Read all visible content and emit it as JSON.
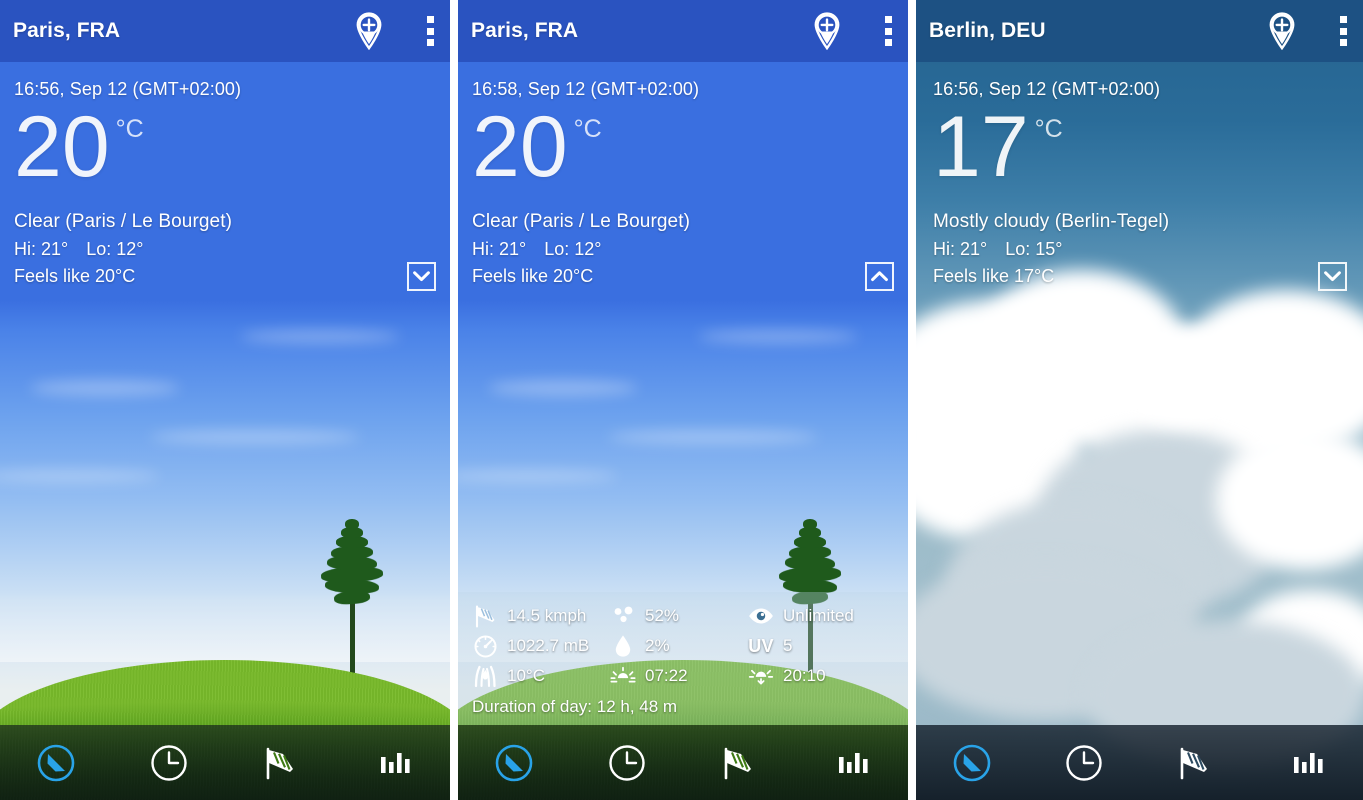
{
  "app": {
    "nav": {
      "items": [
        {
          "name": "now",
          "icon": "navigation-arrow-icon",
          "active": true
        },
        {
          "name": "hourly",
          "icon": "clock-icon",
          "active": false
        },
        {
          "name": "wind",
          "icon": "windsock-icon",
          "active": false
        },
        {
          "name": "charts",
          "icon": "bar-chart-icon",
          "active": false
        }
      ]
    },
    "colors": {
      "header_blue": "#2a53c0",
      "body_blue": "#3a6fe0",
      "header_steel": "#1d5183",
      "body_steel": "#25628f",
      "accent_active": "#29a3e8"
    },
    "header_icons": {
      "add_location": "add-location-pin-icon",
      "overflow_menu": "overflow-menu-icon"
    }
  },
  "panels": [
    {
      "id": "paris-collapsed",
      "title": "Paris, FRA",
      "timestamp": "16:56, Sep 12 (GMT+02:00)",
      "temperature": "20",
      "unit": "°C",
      "condition": "Clear (Paris / Le Bourget)",
      "hi_label": "Hi: 21°",
      "lo_label": "Lo: 12°",
      "feels_like": "Feels like 20°C",
      "expand_state": "collapsed",
      "expand_icon": "chevron-down-icon",
      "scene": "clear-meadow"
    },
    {
      "id": "paris-expanded",
      "title": "Paris, FRA",
      "timestamp": "16:58, Sep 12 (GMT+02:00)",
      "temperature": "20",
      "unit": "°C",
      "condition": "Clear (Paris / Le Bourget)",
      "hi_label": "Hi: 21°",
      "lo_label": "Lo: 12°",
      "feels_like": "Feels like 20°C",
      "expand_state": "expanded",
      "expand_icon": "chevron-up-icon",
      "scene": "clear-meadow",
      "details": {
        "wind": {
          "icon": "windsock-icon",
          "value": "14.5 kmph"
        },
        "pressure": {
          "icon": "barometer-icon",
          "value": "1022.7 mB"
        },
        "dew_point": {
          "icon": "dew-point-icon",
          "value": "10°C"
        },
        "humidity": {
          "icon": "humidity-dots-icon",
          "value": "52%"
        },
        "precipitation": {
          "icon": "raindrop-icon",
          "value": "2%"
        },
        "sunrise": {
          "icon": "sunrise-icon",
          "value": "07:22"
        },
        "visibility": {
          "icon": "eye-icon",
          "value": "Unlimited"
        },
        "uv": {
          "icon": "uv-label",
          "label": "UV",
          "value": "5"
        },
        "sunset": {
          "icon": "sunset-icon",
          "value": "20:10"
        },
        "duration": "Duration of day: 12 h, 48 m"
      }
    },
    {
      "id": "berlin-collapsed",
      "title": "Berlin, DEU",
      "timestamp": "16:56, Sep 12 (GMT+02:00)",
      "temperature": "17",
      "unit": "°C",
      "condition": "Mostly cloudy (Berlin-Tegel)",
      "hi_label": "Hi: 21°",
      "lo_label": "Lo: 15°",
      "feels_like": "Feels like 17°C",
      "expand_state": "collapsed",
      "expand_icon": "chevron-down-icon",
      "scene": "cloudy"
    }
  ]
}
